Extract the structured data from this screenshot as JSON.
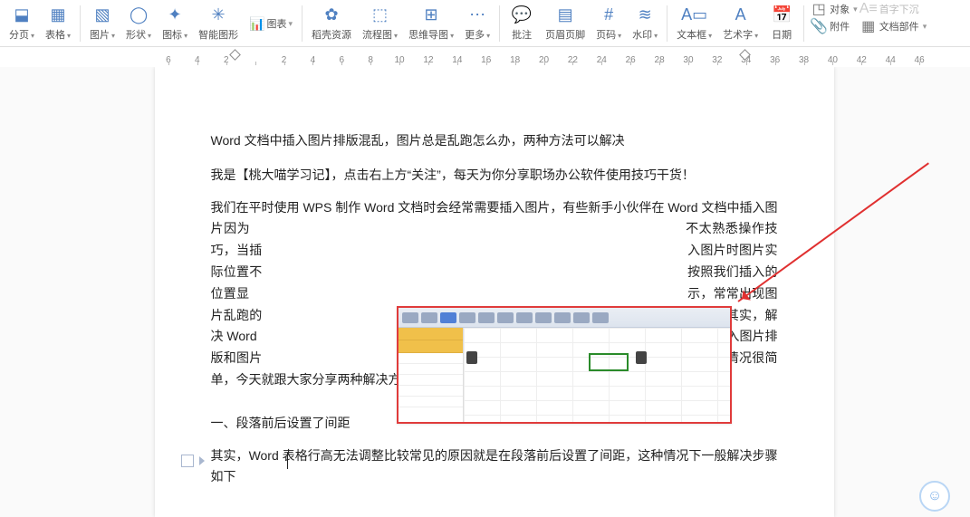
{
  "toolbar": {
    "items": [
      {
        "label": "分页",
        "icon": "pagebreak",
        "dropdown": true
      },
      {
        "label": "表格",
        "icon": "table",
        "dropdown": true
      },
      {
        "label": "图片",
        "icon": "picture",
        "dropdown": true
      },
      {
        "label": "形状",
        "icon": "shapes",
        "dropdown": true
      },
      {
        "label": "图标",
        "icon": "icons",
        "dropdown": true
      },
      {
        "label": "智能图形",
        "icon": "smartart",
        "dropdown": false
      },
      {
        "label": "图表",
        "icon": "chart",
        "dropdown": true,
        "icon_inline": true
      },
      {
        "label": "稻壳资源",
        "icon": "docer",
        "dropdown": false
      },
      {
        "label": "流程图",
        "icon": "flowchart",
        "dropdown": true
      },
      {
        "label": "思维导图",
        "icon": "mindmap",
        "dropdown": true
      },
      {
        "label": "更多",
        "icon": "more",
        "dropdown": true
      },
      {
        "label": "批注",
        "icon": "comment",
        "dropdown": false
      },
      {
        "label": "页眉页脚",
        "icon": "headerfooter",
        "dropdown": false
      },
      {
        "label": "页码",
        "icon": "pagenum",
        "dropdown": true
      },
      {
        "label": "水印",
        "icon": "watermark",
        "dropdown": true
      },
      {
        "label": "文本框",
        "icon": "textbox",
        "dropdown": true
      },
      {
        "label": "艺术字",
        "icon": "wordart",
        "dropdown": true
      },
      {
        "label": "日期",
        "icon": "date",
        "dropdown": false
      }
    ],
    "right": {
      "object_label": "对象",
      "dropcap_label": "首字下沉",
      "attachment_label": "附件",
      "docparts_label": "文档部件"
    }
  },
  "ruler": {
    "ticks": [
      "6",
      "4",
      "2",
      "",
      "2",
      "4",
      "6",
      "8",
      "10",
      "12",
      "14",
      "16",
      "18",
      "20",
      "22",
      "24",
      "26",
      "28",
      "30",
      "32",
      "34",
      "36",
      "38",
      "40",
      "42",
      "44",
      "46"
    ]
  },
  "doc": {
    "p1": "Word 文档中插入图片排版混乱，图片总是乱跑怎么办，两种方法可以解决",
    "p2": "我是【桃大喵学习记】，点击右上方“关注”，每天为你分享职场办公软件使用技巧干货！",
    "p3": "我们在平时使用 WPS 制作 Word 文档时会经常需要插入图片，有些新手小伙伴在 Word 文档中插入图片因为　　　　　　　　　　　　　　　　　　　　　　　　　　　　　　　　　不太熟悉操作技巧，当插　　　　　　　　　　　　　　　　　　　　　　　　　　　　　　　　　入图片时图片实际位置不　　　　　　　　　　　　　　　　　　　　　　　　　　　　　　　　　按照我们插入的位置显　　　　　　　　　　　　　　　　　　　　　　　　　　　　　　　　　　示，常常出现图片乱跑的　　　　　　　　　　　　　　　　　　　　　　　　　　　　　　　　　现象。其实，解决 Word　　　　　　　　　　　　　　　　　　　　　　　　　　　　　　　　　　文档插入图片排版和图片　　　　　　　　　　　　　　　　　　　　　　　　　　　　　　　　　乱跑的情况很简单，今天就跟大家分享两种解决方法。",
    "p4": "一、段落前后设置了间距",
    "p5": "其实，Word 表格行高无法调整比较常见的原因就是在段落前后设置了间距，这种情况下一般解决步骤如下"
  },
  "embedded_labels": {
    "tag1": "",
    "tag2": ""
  }
}
